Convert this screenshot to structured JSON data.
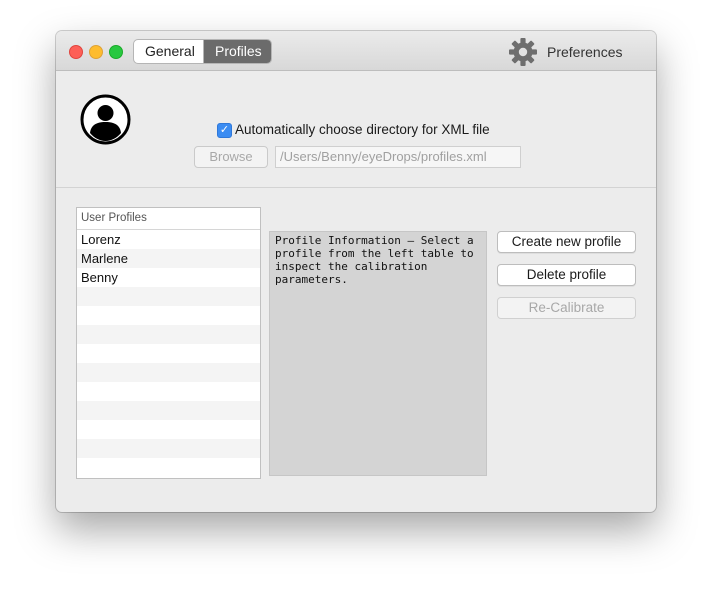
{
  "titlebar": {
    "tabs": [
      {
        "label": "General",
        "selected": false
      },
      {
        "label": "Profiles",
        "selected": true
      }
    ],
    "preferences_label": "Preferences",
    "preferences_icon": "gear-icon"
  },
  "header": {
    "avatar_icon": "user-avatar-icon",
    "auto_dir_checked": true,
    "auto_dir_label": "Automatically choose directory for XML file",
    "browse_label": "Browse",
    "path_value": "/Users/Benny/eyeDrops/profiles.xml"
  },
  "profiles_table": {
    "header": "User Profiles",
    "rows": [
      "Lorenz",
      "Marlene",
      "Benny"
    ]
  },
  "info_text": "Profile Information – Select a profile from the left table to inspect the calibration parameters.",
  "buttons": {
    "create": "Create new profile",
    "delete": "Delete profile",
    "recalibrate": "Re-Calibrate"
  },
  "colors": {
    "accent": "#3b8cf2",
    "selected_tab": "#6b6b6b"
  }
}
